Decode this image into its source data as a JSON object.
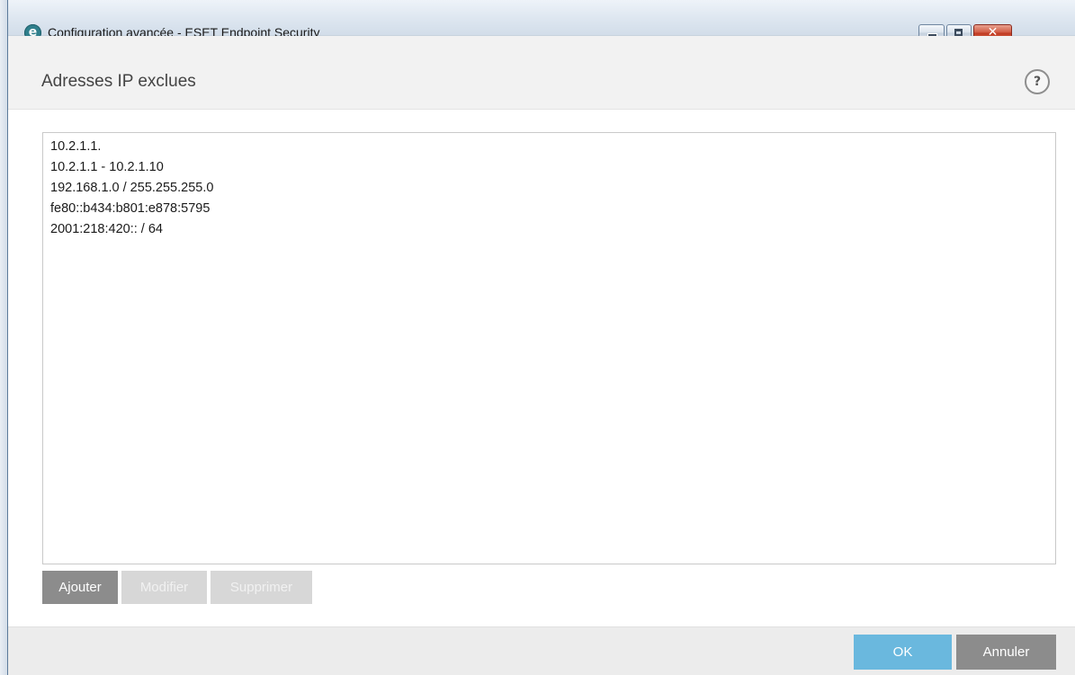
{
  "window": {
    "title": "Configuration avancée - ESET Endpoint Security",
    "app_icon_letter": "e",
    "minimize_glyph": "",
    "maximize_glyph": "",
    "close_glyph": "✕"
  },
  "header": {
    "title": "Adresses IP exclues",
    "help_glyph": "?"
  },
  "ip_list": {
    "items": [
      "10.2.1.1.",
      "10.2.1.1 - 10.2.1.10",
      "192.168.1.0 / 255.255.255.0",
      "fe80::b434:b801:e878:5795",
      "2001:218:420:: / 64"
    ]
  },
  "actions": {
    "add_label": "Ajouter",
    "edit_label": "Modifier",
    "delete_label": "Supprimer",
    "edit_enabled": false,
    "delete_enabled": false
  },
  "footer": {
    "ok_label": "OK",
    "cancel_label": "Annuler"
  },
  "colors": {
    "ok_button": "#6ab8de",
    "primary_gray_button": "#8c8c8c",
    "disabled_button": "#d7d7d7",
    "header_background": "#f2f2f2",
    "footer_background": "#ececec",
    "app_icon": "#2f7f8c",
    "close_button": "#c8452c"
  },
  "icons": {
    "app": "eset-logo-icon",
    "help": "help-icon",
    "minimize": "minimize-icon",
    "maximize": "maximize-icon",
    "close": "close-icon"
  }
}
